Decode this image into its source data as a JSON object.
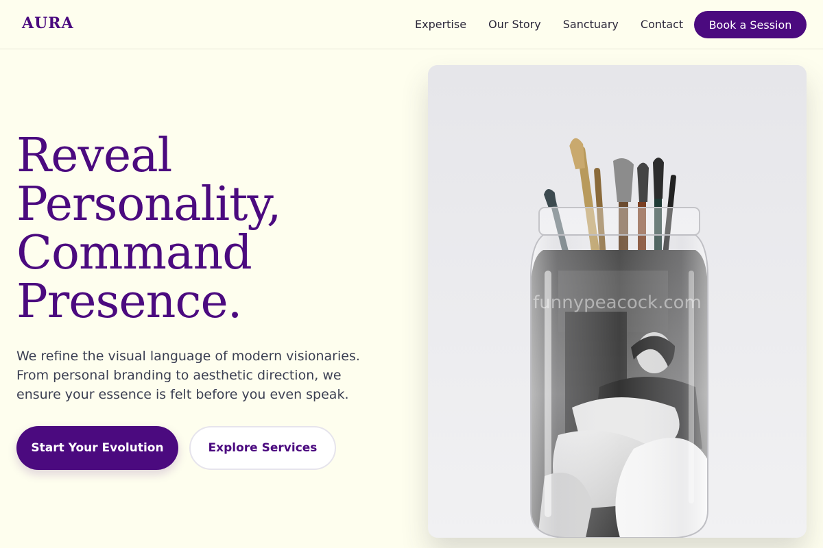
{
  "brand": {
    "logo": "AURA",
    "accent": "#4b0a7f",
    "background": "#fefeee"
  },
  "nav": {
    "links": [
      "Expertise",
      "Our Story",
      "Sanctuary",
      "Contact"
    ],
    "cta": "Book a Session"
  },
  "hero": {
    "title_lines": [
      "Reveal",
      "Personality,",
      "Command",
      "Presence."
    ],
    "body_lines": [
      "We refine the visual language of modern visionaries.",
      "From personal branding to aesthetic direction, we",
      "ensure your essence is felt before you even speak."
    ],
    "primary_button": "Start Your Evolution",
    "secondary_button": "Explore Services",
    "image": {
      "subject": "paintbrushes in a glass jar with black-and-white photograph",
      "watermark": "funnypeacock.com"
    }
  }
}
